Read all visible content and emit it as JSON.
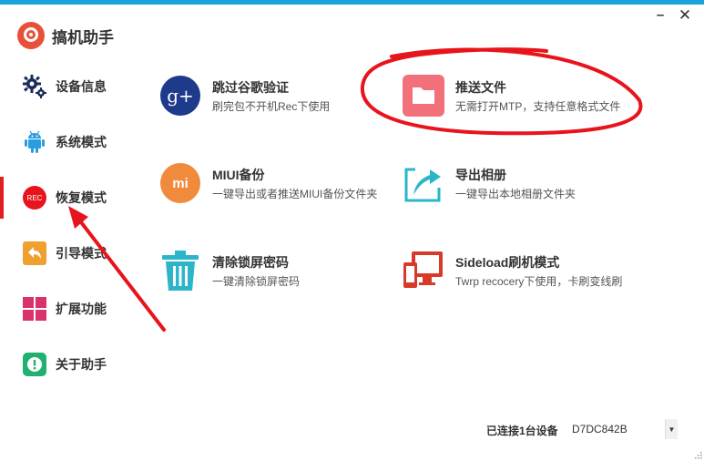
{
  "app": {
    "title": "搞机助手"
  },
  "window": {
    "minimize": "–",
    "close": "✕"
  },
  "sidebar": {
    "items": [
      {
        "label": "设备信息",
        "icon": "gear-icon"
      },
      {
        "label": "系统模式",
        "icon": "android-icon"
      },
      {
        "label": "恢复模式",
        "icon": "rec-icon",
        "icon_text": "REC",
        "active": true
      },
      {
        "label": "引导模式",
        "icon": "back-arrow-icon"
      },
      {
        "label": "扩展功能",
        "icon": "grid-icon"
      },
      {
        "label": "关于助手",
        "icon": "info-icon"
      }
    ]
  },
  "features": [
    {
      "title": "跳过谷歌验证",
      "desc": "刷完包不开机Rec下使用",
      "icon": "google-plus-icon",
      "icon_text": "g+"
    },
    {
      "title": "推送文件",
      "desc": "无需打开MTP，支持任意格式文件",
      "icon": "folder-icon"
    },
    {
      "title": "MIUI备份",
      "desc": "一键导出或者推送MIUI备份文件夹",
      "icon": "mi-icon",
      "icon_text": "mi"
    },
    {
      "title": "导出相册",
      "desc": "一键导出本地相册文件夹",
      "icon": "export-icon"
    },
    {
      "title": "清除锁屏密码",
      "desc": "一键清除锁屏密码",
      "icon": "trash-icon"
    },
    {
      "title": "Sideload刷机模式",
      "desc": "Twrp recocery下使用，卡刷变线刷",
      "icon": "devices-icon"
    }
  ],
  "footer": {
    "status": "已连接1台设备",
    "device": "D7DC842B",
    "dropdown_arrow": "▼"
  },
  "colors": {
    "accent_bar": "#1aa3d9",
    "annotation_red": "#e8141c",
    "google_blue": "#1e3a8a",
    "folder_red": "#f2707a",
    "mi_orange": "#f08a3c",
    "teal": "#2bb5c8",
    "device_red": "#d83a2a",
    "grid_pink": "#d8336c",
    "info_green": "#20b070"
  }
}
